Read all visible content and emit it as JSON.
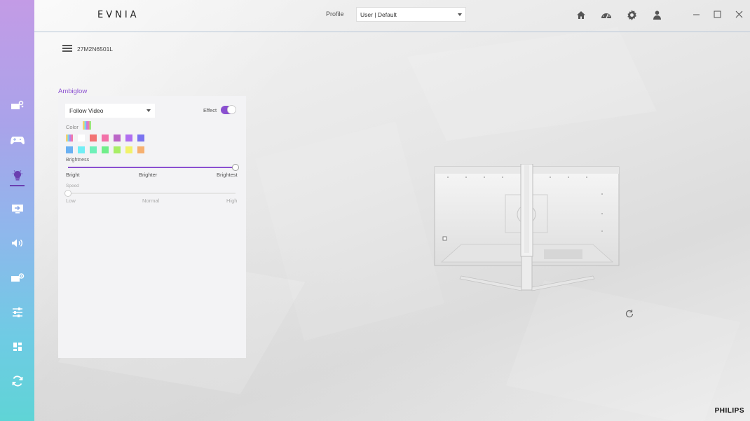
{
  "app": {
    "logo": "EVNIA",
    "brand": "PHILIPS"
  },
  "header": {
    "profile_label": "Profile",
    "profile_value": "User | Default"
  },
  "device": {
    "name": "27M2N6501L"
  },
  "ambiglow": {
    "title": "Ambiglow",
    "mode_value": "Follow Video",
    "effect_label": "Effect",
    "effect_on": true,
    "color_label": "Color",
    "swatches_row1": [
      "rainbow",
      "#ffffff",
      "#f27373",
      "#f271a8",
      "#bb66c7",
      "#b06ef0",
      "#7a73f0"
    ],
    "swatches_row2": [
      "#6ab0f2",
      "#70eef5",
      "#6ff0b8",
      "#70ee8a",
      "#a8ee66",
      "#f2f26a",
      "#f6b070"
    ],
    "brightness": {
      "label": "Brightness",
      "value": 1.0,
      "ticks": [
        "Bright",
        "Brighter",
        "Brightest"
      ]
    },
    "speed": {
      "label": "Speed",
      "value": 0.0,
      "ticks": [
        "Low",
        "Normal",
        "High"
      ],
      "enabled": false
    }
  },
  "colors": {
    "accent": "#8a4fd0"
  },
  "rail_icons": [
    "picture-icon",
    "gamepad-icon",
    "ambiglow-bulb-icon",
    "input-icon",
    "audio-icon",
    "pip-icon",
    "settings-sliders-icon",
    "dashboard-icon",
    "sync-icon"
  ]
}
